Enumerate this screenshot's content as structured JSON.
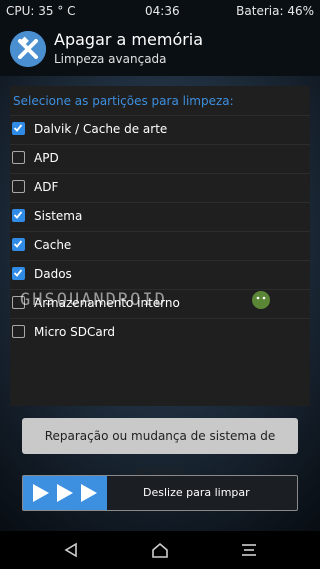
{
  "status": {
    "cpu": "CPU: 35 ° C",
    "time": "04:36",
    "battery": "Bateria: 46%"
  },
  "header": {
    "title": "Apagar a memória",
    "subtitle": "Limpeza avançada"
  },
  "panel": {
    "title": "Selecione as partições para limpeza:",
    "partitions": [
      {
        "label": "Dalvik / Cache de arte",
        "checked": true
      },
      {
        "label": "APD",
        "checked": false
      },
      {
        "label": "ADF",
        "checked": false
      },
      {
        "label": "Sistema",
        "checked": true
      },
      {
        "label": "Cache",
        "checked": true
      },
      {
        "label": "Dados",
        "checked": true
      },
      {
        "label": "Armazenamento interno",
        "checked": false
      },
      {
        "label": "Micro SDCard",
        "checked": false
      }
    ]
  },
  "watermark": "GHSQUANDROID",
  "repair_button": "Reparação ou mudança de sistema de arquivos",
  "slider": {
    "label": "Deslize para limpar"
  },
  "colors": {
    "accent": "#3d8fe0",
    "checkbox_checked": "#2f8be6",
    "panel_bg": "#1f1f1f"
  },
  "icons": {
    "logo": "twrp-logo-icon",
    "back": "back-triangle-icon",
    "home": "home-icon",
    "menu": "menu-lines-icon"
  }
}
